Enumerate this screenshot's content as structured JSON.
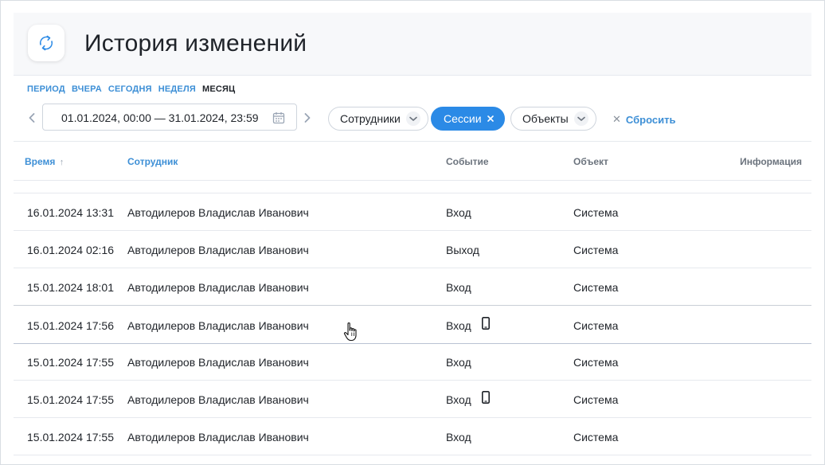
{
  "header": {
    "title": "История изменений",
    "app_icon": "refresh-icon"
  },
  "period": {
    "label": "ПЕРИОД",
    "options": [
      "ВЧЕРА",
      "СЕГОДНЯ",
      "НЕДЕЛЯ",
      "МЕСЯЦ"
    ],
    "active": "МЕСЯЦ"
  },
  "filters": {
    "date_range": "01.01.2024, 00:00 — 31.01.2024, 23:59",
    "employees_label": "Сотрудники",
    "sessions_label": "Сессии",
    "objects_label": "Объекты",
    "reset_label": "Сбросить"
  },
  "table": {
    "columns": {
      "time": "Время",
      "employee": "Сотрудник",
      "event": "Событие",
      "object": "Объект",
      "info": "Информация"
    },
    "sort_indicator": "↑",
    "rows": [
      {
        "time": "16.01.2024 13:31",
        "employee": "Автодилеров Владислав Иванович",
        "event": "Вход",
        "object": "Система",
        "mobile": false
      },
      {
        "time": "16.01.2024 02:16",
        "employee": "Автодилеров Владислав Иванович",
        "event": "Выход",
        "object": "Система",
        "mobile": false
      },
      {
        "time": "15.01.2024 18:01",
        "employee": "Автодилеров Владислав Иванович",
        "event": "Вход",
        "object": "Система",
        "mobile": false
      },
      {
        "time": "15.01.2024 17:56",
        "employee": "Автодилеров Владислав Иванович",
        "event": "Вход",
        "object": "Система",
        "mobile": true
      },
      {
        "time": "15.01.2024 17:55",
        "employee": "Автодилеров Владислав Иванович",
        "event": "Вход",
        "object": "Система",
        "mobile": false
      },
      {
        "time": "15.01.2024 17:55",
        "employee": "Автодилеров Владислав Иванович",
        "event": "Вход",
        "object": "Система",
        "mobile": true
      },
      {
        "time": "15.01.2024 17:55",
        "employee": "Автодилеров Владислав Иванович",
        "event": "Вход",
        "object": "Система",
        "mobile": false
      }
    ]
  },
  "colors": {
    "accent": "#2b8ae6",
    "link": "#3d8fd6",
    "text": "#1f2329"
  }
}
